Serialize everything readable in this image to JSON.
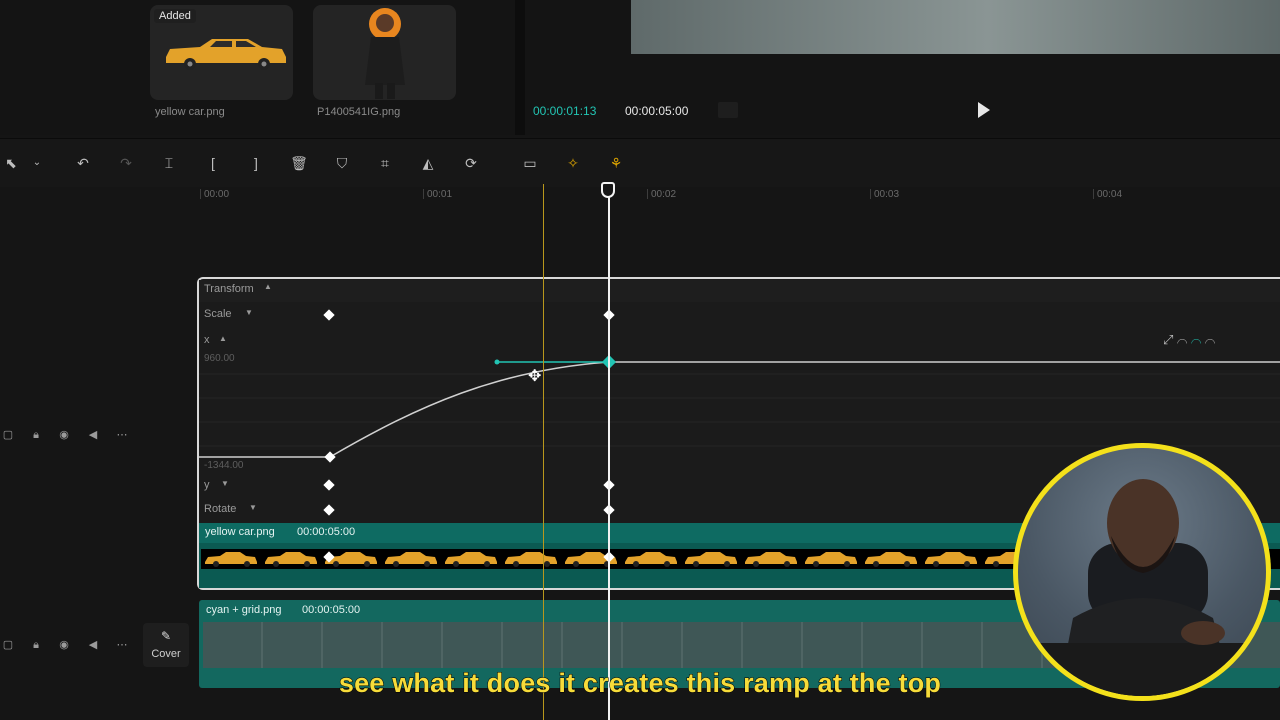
{
  "media": {
    "added_badge": "Added",
    "items": [
      {
        "name": "yellow car.png"
      },
      {
        "name": "P1400541IG.png"
      }
    ]
  },
  "preview": {
    "current_time": "00:00:01:13",
    "total_time": "00:00:05:00"
  },
  "toolbar": {
    "icons": [
      "select-icon",
      "undo-icon",
      "redo-icon",
      "split-icon",
      "trim-left-icon",
      "trim-right-icon",
      "delete-icon",
      "shield-icon",
      "crop-icon",
      "mirror-icon",
      "rotate-icon",
      "caption-icon",
      "magic-icon",
      "auto-reframe-icon"
    ]
  },
  "ruler": {
    "ticks": [
      "00:00",
      "00:01",
      "00:02",
      "00:03",
      "00:04"
    ]
  },
  "keyframes": {
    "transform_label": "Transform",
    "scale_label": "Scale",
    "x_label": "x",
    "x_max": "960.00",
    "x_min": "-1344.00",
    "y_label": "y",
    "rotate_label": "Rotate"
  },
  "clips": {
    "car": {
      "name": "yellow car.png",
      "duration": "00:00:05:00"
    },
    "grid": {
      "name": "cyan + grid.png",
      "duration": "00:00:05:00"
    }
  },
  "cover_label": "Cover",
  "subtitle": "see what it does it creates this ramp at the top",
  "colors": {
    "accent_teal": "#22c4b3",
    "subtitle_yellow": "#f7dc3a",
    "webcam_ring": "#f4e11b"
  }
}
